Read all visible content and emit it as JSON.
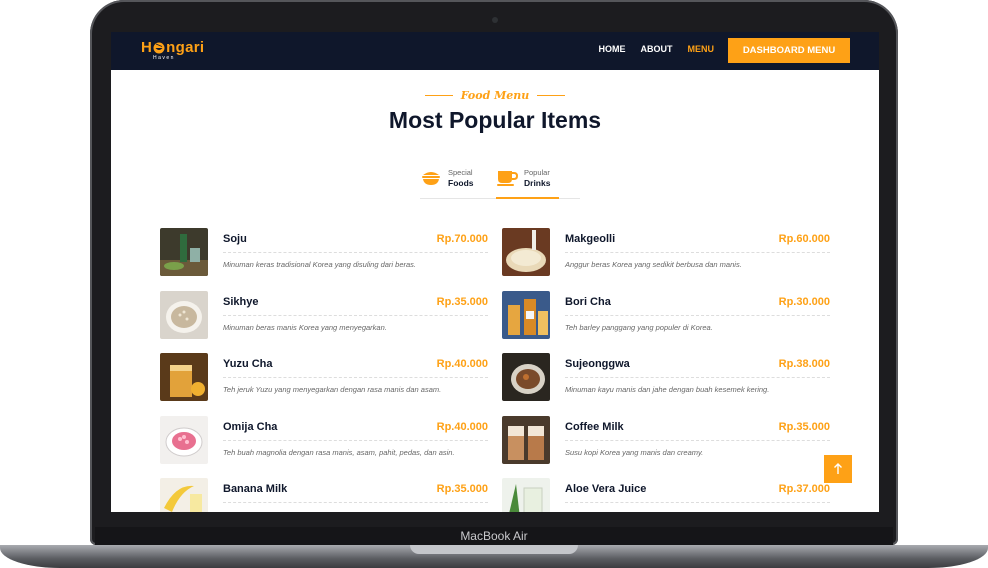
{
  "device": {
    "label": "MacBook Air"
  },
  "brand": {
    "name_part1": "H",
    "name_part2": "ngari",
    "sub": "Haven"
  },
  "nav": {
    "links": [
      {
        "label": "HOME",
        "active": false
      },
      {
        "label": "ABOUT",
        "active": false
      },
      {
        "label": "MENU",
        "active": true
      }
    ],
    "cta": "DASHBOARD MENU"
  },
  "header": {
    "subtitle": "Food Menu",
    "title": "Most Popular Items"
  },
  "tabs": [
    {
      "small": "Special",
      "big": "Foods",
      "icon": "bowl-icon",
      "active": false
    },
    {
      "small": "Popular",
      "big": "Drinks",
      "icon": "coffee-cup-icon",
      "active": true
    }
  ],
  "items": [
    {
      "name": "Soju",
      "price": "Rp.70.000",
      "desc": "Minuman keras tradisional Korea yang disuling dari beras."
    },
    {
      "name": "Makgeolli",
      "price": "Rp.60.000",
      "desc": "Anggur beras Korea yang sedikit berbusa dan manis."
    },
    {
      "name": "Sikhye",
      "price": "Rp.35.000",
      "desc": "Minuman beras manis Korea yang menyegarkan."
    },
    {
      "name": "Bori Cha",
      "price": "Rp.30.000",
      "desc": "Teh barley panggang yang populer di Korea."
    },
    {
      "name": "Yuzu Cha",
      "price": "Rp.40.000",
      "desc": "Teh jeruk Yuzu yang menyegarkan dengan rasa manis dan asam."
    },
    {
      "name": "Sujeonggwa",
      "price": "Rp.38.000",
      "desc": "Minuman kayu manis dan jahe dengan buah kesemek kering."
    },
    {
      "name": "Omija Cha",
      "price": "Rp.40.000",
      "desc": "Teh buah magnolia dengan rasa manis, asam, pahit, pedas, dan asin."
    },
    {
      "name": "Coffee Milk",
      "price": "Rp.35.000",
      "desc": "Susu kopi Korea yang manis dan creamy."
    },
    {
      "name": "Banana Milk",
      "price": "Rp.35.000",
      "desc": ""
    },
    {
      "name": "Aloe Vera Juice",
      "price": "Rp.37.000",
      "desc": ""
    }
  ],
  "colors": {
    "accent": "#fea116",
    "navy": "#0f172b"
  }
}
